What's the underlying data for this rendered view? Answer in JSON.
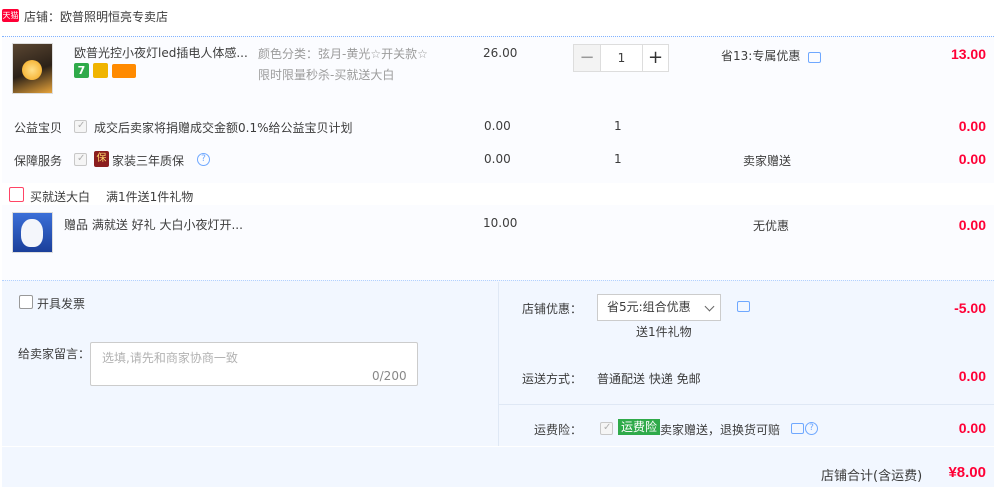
{
  "shop": {
    "badge": "天猫",
    "name": "店铺：欧普照明恒亮专卖店"
  },
  "product": {
    "title": "欧普光控小夜灯led插电人体感...",
    "tag1": "7",
    "sku_line1": "颜色分类：弦月-黄光☆开关款☆",
    "sku_line2": "限时限量秒杀-买就送大白",
    "price": "26.00",
    "qty": "1",
    "qty_minus": "−",
    "qty_plus": "+",
    "discount": "省13:专属优惠",
    "subtotal": "13.00"
  },
  "charity": {
    "label": "公益宝贝",
    "desc": "成交后卖家将捐赠成交金额0.1%给公益宝贝计划",
    "price": "0.00",
    "qty": "1",
    "subtotal": "0.00"
  },
  "guarantee": {
    "label": "保障服务",
    "icon_text": "保",
    "desc": "家装三年质保",
    "price": "0.00",
    "qty": "1",
    "note": "卖家赠送",
    "subtotal": "0.00"
  },
  "promo": {
    "title": "买就送大白",
    "desc": "满1件送1件礼物"
  },
  "gift": {
    "title": "赠品 满就送 好礼 大白小夜灯开...",
    "price": "10.00",
    "note": "无优惠",
    "subtotal": "0.00"
  },
  "order": {
    "invoice_label": "开具发票",
    "message_label": "给卖家留言：",
    "message_placeholder": "选填,请先和商家协商一致",
    "message_count": "0/200",
    "shop_discount_label": "店铺优惠：",
    "shop_discount_value": "省5元:组合优惠",
    "shop_discount_sub": "送1件礼物",
    "shop_discount_amount": "-5.00",
    "shipping_label": "运送方式：",
    "shipping_value": "普通配送 快递 免邮",
    "shipping_amount": "0.00",
    "insurance_label": "运费险：",
    "insurance_badge": "运费险",
    "insurance_desc": "卖家赠送，退换货可赔",
    "insurance_amount": "0.00"
  },
  "total": {
    "label": "店铺合计(含运费)",
    "amount": "¥8.00"
  },
  "colors": {
    "accent_red": "#ff0036",
    "link_blue": "#6fa8ff",
    "insurance_green": "#2faa4a",
    "panel_bg": "#f2f7ff"
  }
}
